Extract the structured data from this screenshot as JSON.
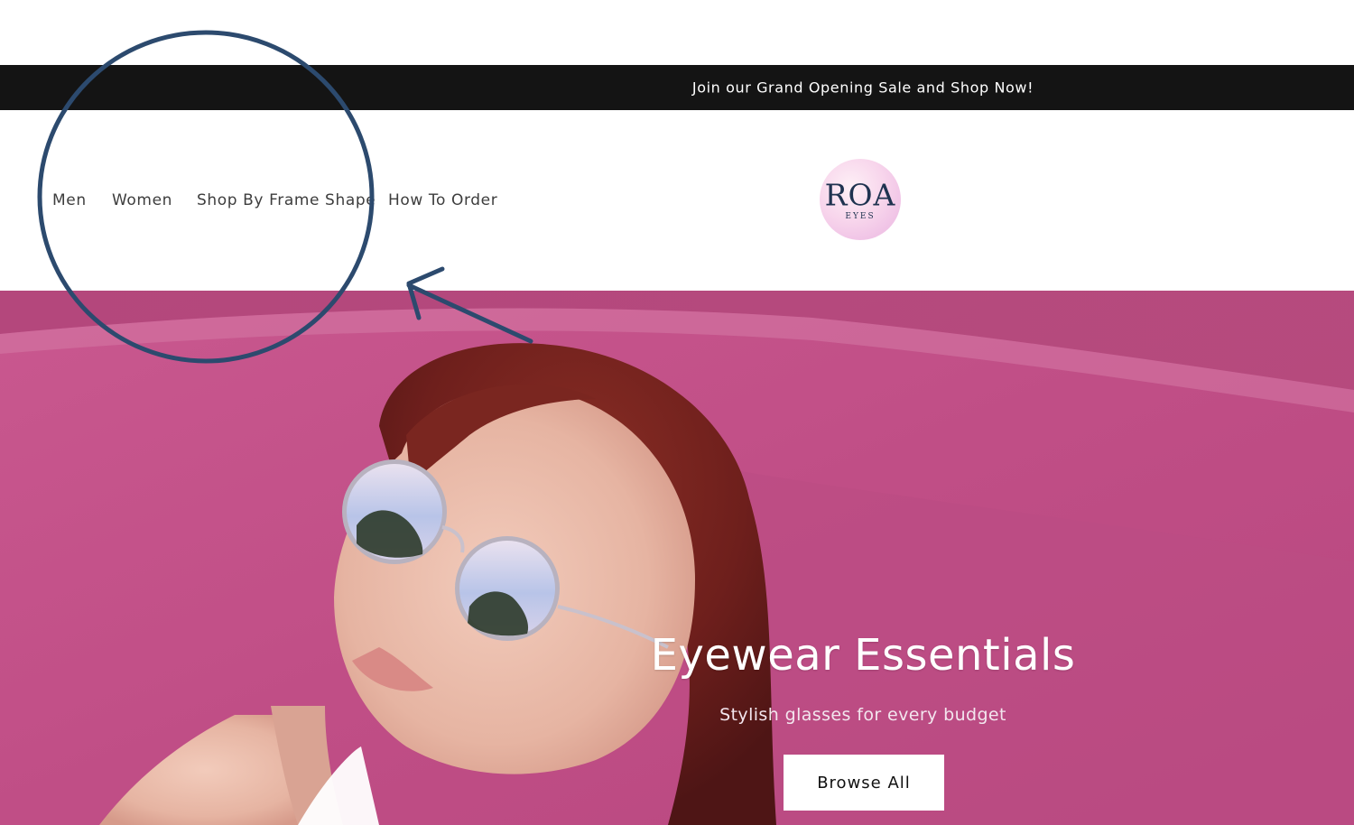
{
  "announcement": {
    "text": "Join our Grand Opening Sale and Shop Now!"
  },
  "nav": {
    "men": "Men",
    "women": "Women",
    "shop_by_frame_shape": "Shop By Frame Shape",
    "how_to_order": "How To Order"
  },
  "logo": {
    "main": "ROA",
    "sub": "EYES"
  },
  "hero": {
    "title": "Eyewear Essentials",
    "subtitle": "Stylish glasses for every budget",
    "button_label": "Browse All"
  },
  "colors": {
    "announcement_bar": "#141414",
    "hero_pink": "#c2508a",
    "logo_text": "#1f3350",
    "annotation_stroke": "#2c4a6e"
  }
}
